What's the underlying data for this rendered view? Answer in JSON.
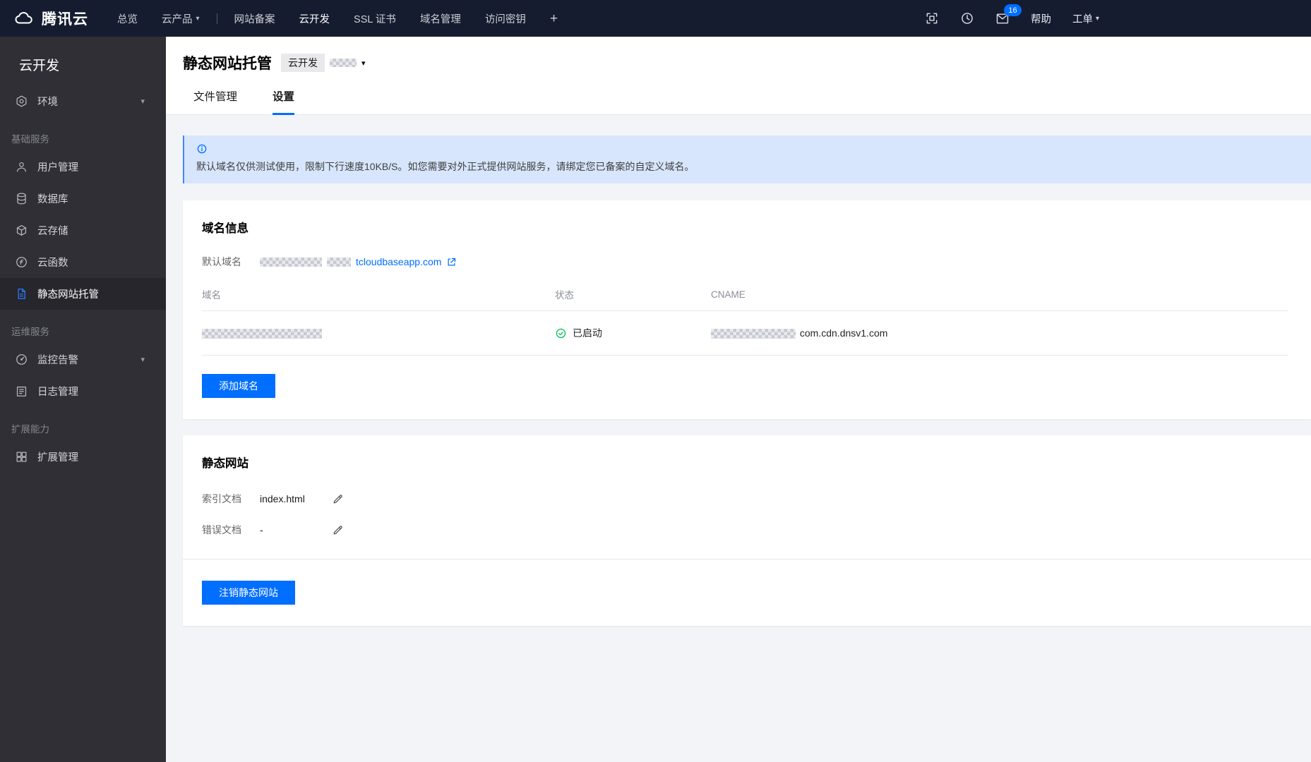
{
  "colors": {
    "accent": "#006eff",
    "success": "#0abf5b",
    "banner_bg": "#d7e6fc"
  },
  "topbar": {
    "brand": "腾讯云",
    "nav": [
      {
        "label": "总览"
      },
      {
        "label": "云产品"
      },
      {
        "label": "网站备案"
      },
      {
        "label": "云开发"
      },
      {
        "label": "SSL 证书"
      },
      {
        "label": "域名管理"
      },
      {
        "label": "访问密钥"
      },
      {
        "label": "+"
      }
    ],
    "mail_badge": "16",
    "help": "帮助",
    "ticket": "工单"
  },
  "sidebar": {
    "title": "云开发",
    "env": "环境",
    "sections": {
      "basic": "基础服务",
      "ops": "运维服务",
      "ext": "扩展能力"
    },
    "items": [
      {
        "label": "用户管理"
      },
      {
        "label": "数据库"
      },
      {
        "label": "云存储"
      },
      {
        "label": "云函数"
      },
      {
        "label": "静态网站托管"
      },
      {
        "label": "监控告警"
      },
      {
        "label": "日志管理"
      },
      {
        "label": "扩展管理"
      }
    ]
  },
  "page": {
    "title": "静态网站托管",
    "env_tag": "云开发",
    "tabs": [
      {
        "label": "文件管理"
      },
      {
        "label": "设置"
      }
    ],
    "banner_text": "默认域名仅供测试使用，限制下行速度10KB/S。如您需要对外正式提供网站服务，请绑定您已备案的自定义域名。"
  },
  "domain_card": {
    "title": "域名信息",
    "default_domain_label": "默认域名",
    "default_domain_visible": "tcloudbaseapp.com",
    "table_headers": [
      "域名",
      "状态",
      "CNAME"
    ],
    "row": {
      "status": "已启动",
      "cname_visible": "com.cdn.dnsv1.com"
    },
    "add_domain_button": "添加域名"
  },
  "static_card": {
    "title": "静态网站",
    "index_label": "索引文档",
    "index_value": "index.html",
    "error_label": "错误文档",
    "error_value": "-",
    "deregister_button": "注销静态网站"
  }
}
